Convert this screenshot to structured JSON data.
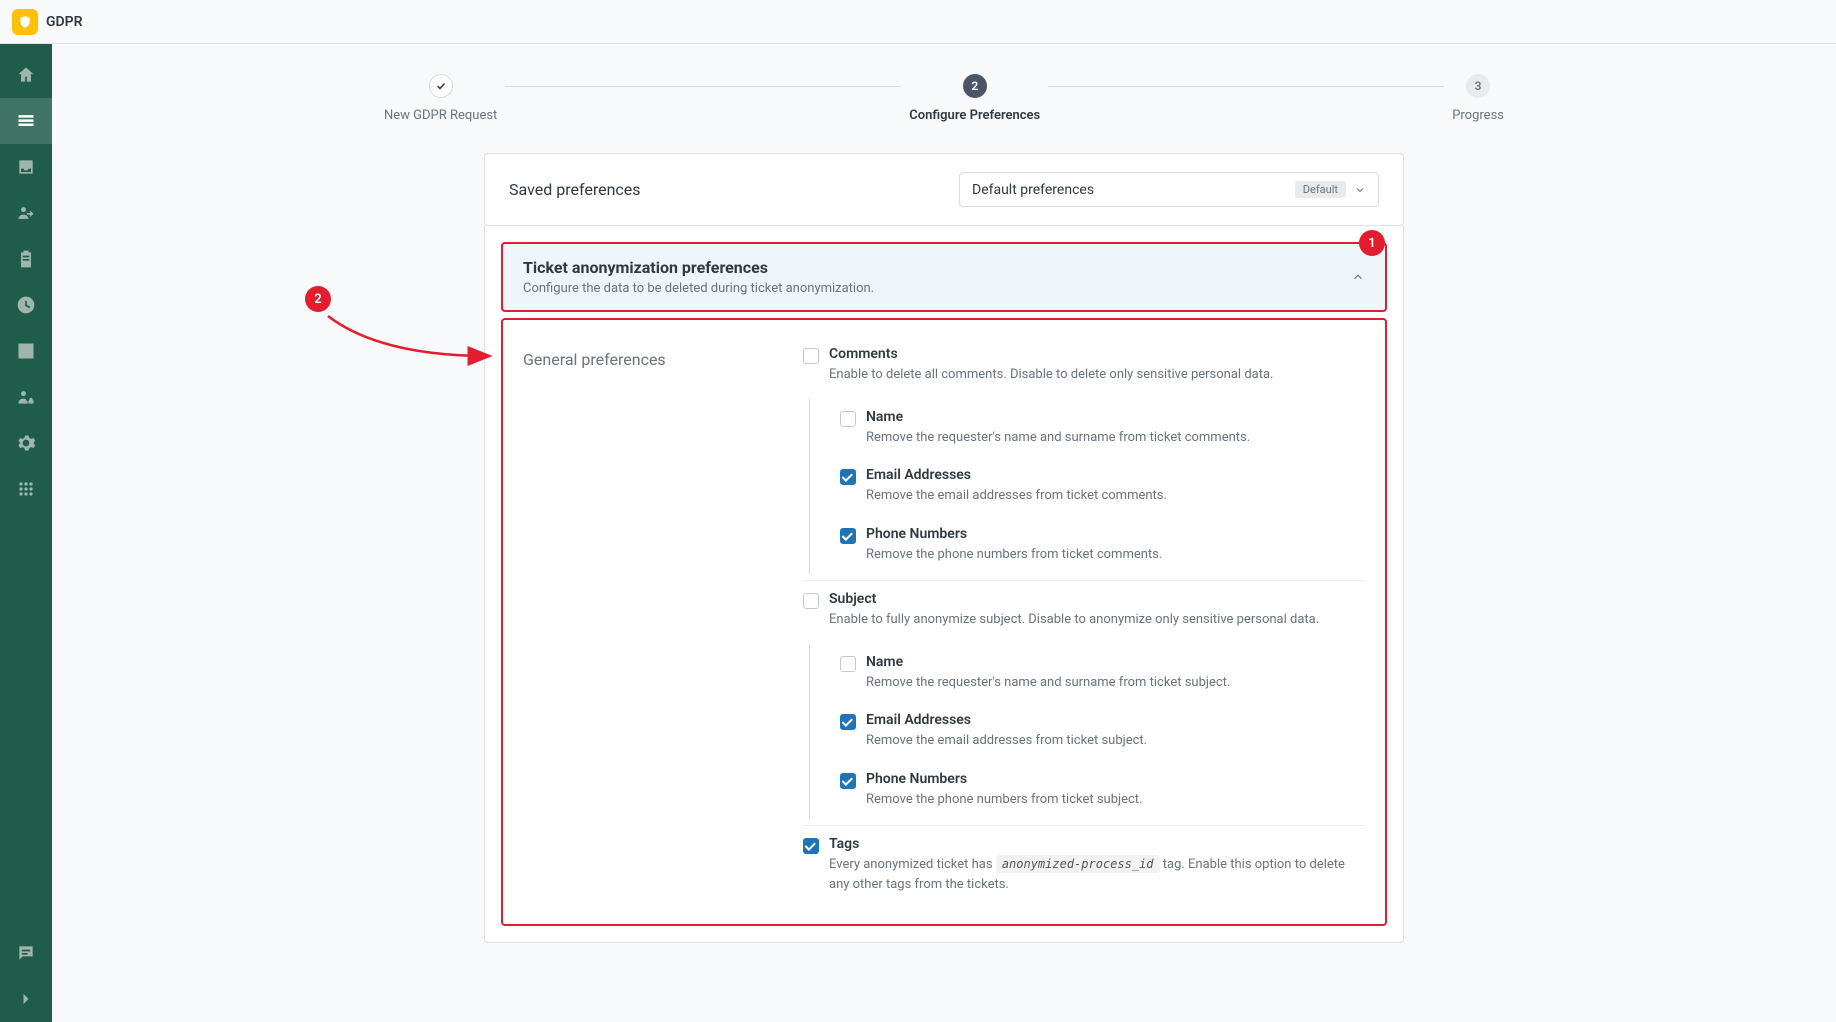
{
  "header": {
    "title": "GDPR"
  },
  "stepper": {
    "step1": {
      "label": "New GDPR Request"
    },
    "step2": {
      "label": "Configure Preferences",
      "number": "2"
    },
    "step3": {
      "label": "Progress",
      "number": "3"
    }
  },
  "savedPrefs": {
    "title": "Saved preferences",
    "selected": "Default preferences",
    "badge": "Default"
  },
  "callouts": {
    "one": "1",
    "two": "2"
  },
  "accordion": {
    "title": "Ticket anonymization preferences",
    "subtitle": "Configure the data to be deleted during ticket anonymization."
  },
  "general": {
    "title": "General preferences",
    "comments": {
      "label": "Comments",
      "desc": "Enable to delete all comments. Disable to delete only sensitive personal data.",
      "name": {
        "label": "Name",
        "desc": "Remove the requester's name and surname from ticket comments."
      },
      "email": {
        "label": "Email Addresses",
        "desc": "Remove the email addresses from ticket comments."
      },
      "phone": {
        "label": "Phone Numbers",
        "desc": "Remove the phone numbers from ticket comments."
      }
    },
    "subject": {
      "label": "Subject",
      "desc": "Enable to fully anonymize subject. Disable to anonymize only sensitive personal data.",
      "name": {
        "label": "Name",
        "desc": "Remove the requester's name and surname from ticket subject."
      },
      "email": {
        "label": "Email Addresses",
        "desc": "Remove the email addresses from ticket subject."
      },
      "phone": {
        "label": "Phone Numbers",
        "desc": "Remove the phone numbers from ticket subject."
      }
    },
    "tags": {
      "label": "Tags",
      "descPre": "Every anonymized ticket has ",
      "code": "anonymized-process_id",
      "descPost": " tag. Enable this option to delete any other tags from the tickets."
    }
  }
}
